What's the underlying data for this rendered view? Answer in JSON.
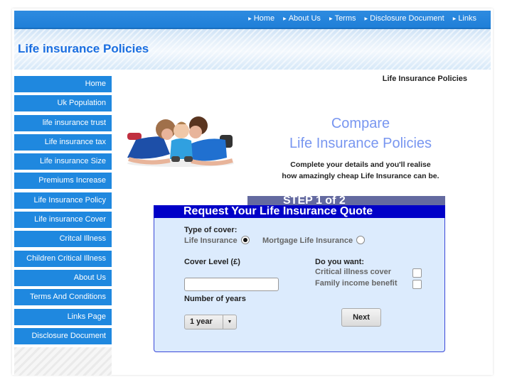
{
  "topnav": {
    "items": [
      "Home",
      "About Us",
      "Terms",
      "Disclosure Document",
      "Links"
    ]
  },
  "banner": {
    "title": "Life insurance Policies"
  },
  "sidebar": {
    "items": [
      "Home",
      "Uk Population",
      "life insurance trust",
      "Life insurance tax",
      "Life insurance Size",
      "Premiums Increase",
      "Life Insurance Policy",
      "Life insurance Cover",
      "Critcal Illness",
      "Children Critical Illness",
      "About Us",
      "Terms And Conditions",
      "Links Page",
      "Disclosure Document"
    ]
  },
  "content": {
    "breadcrumb": "Life Insurance Policies",
    "headline_line1": "Compare",
    "headline_line2": "Life Insurance Policies",
    "tagline_line1": "Complete your details and you'll realise",
    "tagline_line2": "how amazingly cheap Life Insurance can be.",
    "photo_alt": "family-photo"
  },
  "form": {
    "step": "STEP 1 of 2",
    "title": "Request Your Life Insurance Quote",
    "type_of_cover_label": "Type of cover:",
    "cover_options": [
      {
        "label": "Life Insurance",
        "selected": true
      },
      {
        "label": "Mortgage Life Insurance",
        "selected": false
      }
    ],
    "cover_level_label": "Cover Level (£)",
    "cover_level_value": "",
    "years_label": "Number of years",
    "years_selected": "1 year",
    "extras_label": "Do you want:",
    "extras": [
      {
        "label": "Critical illness cover",
        "checked": false
      },
      {
        "label": "Family income benefit",
        "checked": false
      }
    ],
    "next_label": "Next"
  },
  "colors": {
    "nav_blue": "#1f88df",
    "title_blue": "#1a6ee0",
    "headline": "#7896f0",
    "form_header": "#0000c8",
    "step_bar": "#646aa0",
    "form_bg": "#dcebfd"
  }
}
